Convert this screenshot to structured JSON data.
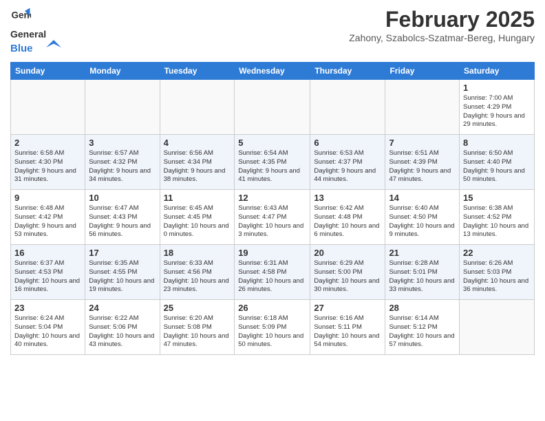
{
  "header": {
    "logo_general": "General",
    "logo_blue": "Blue",
    "month_title": "February 2025",
    "location": "Zahony, Szabolcs-Szatmar-Bereg, Hungary"
  },
  "weekdays": [
    "Sunday",
    "Monday",
    "Tuesday",
    "Wednesday",
    "Thursday",
    "Friday",
    "Saturday"
  ],
  "weeks": [
    [
      {
        "day": "",
        "info": ""
      },
      {
        "day": "",
        "info": ""
      },
      {
        "day": "",
        "info": ""
      },
      {
        "day": "",
        "info": ""
      },
      {
        "day": "",
        "info": ""
      },
      {
        "day": "",
        "info": ""
      },
      {
        "day": "1",
        "info": "Sunrise: 7:00 AM\nSunset: 4:29 PM\nDaylight: 9 hours and 29 minutes."
      }
    ],
    [
      {
        "day": "2",
        "info": "Sunrise: 6:58 AM\nSunset: 4:30 PM\nDaylight: 9 hours and 31 minutes."
      },
      {
        "day": "3",
        "info": "Sunrise: 6:57 AM\nSunset: 4:32 PM\nDaylight: 9 hours and 34 minutes."
      },
      {
        "day": "4",
        "info": "Sunrise: 6:56 AM\nSunset: 4:34 PM\nDaylight: 9 hours and 38 minutes."
      },
      {
        "day": "5",
        "info": "Sunrise: 6:54 AM\nSunset: 4:35 PM\nDaylight: 9 hours and 41 minutes."
      },
      {
        "day": "6",
        "info": "Sunrise: 6:53 AM\nSunset: 4:37 PM\nDaylight: 9 hours and 44 minutes."
      },
      {
        "day": "7",
        "info": "Sunrise: 6:51 AM\nSunset: 4:39 PM\nDaylight: 9 hours and 47 minutes."
      },
      {
        "day": "8",
        "info": "Sunrise: 6:50 AM\nSunset: 4:40 PM\nDaylight: 9 hours and 50 minutes."
      }
    ],
    [
      {
        "day": "9",
        "info": "Sunrise: 6:48 AM\nSunset: 4:42 PM\nDaylight: 9 hours and 53 minutes."
      },
      {
        "day": "10",
        "info": "Sunrise: 6:47 AM\nSunset: 4:43 PM\nDaylight: 9 hours and 56 minutes."
      },
      {
        "day": "11",
        "info": "Sunrise: 6:45 AM\nSunset: 4:45 PM\nDaylight: 10 hours and 0 minutes."
      },
      {
        "day": "12",
        "info": "Sunrise: 6:43 AM\nSunset: 4:47 PM\nDaylight: 10 hours and 3 minutes."
      },
      {
        "day": "13",
        "info": "Sunrise: 6:42 AM\nSunset: 4:48 PM\nDaylight: 10 hours and 6 minutes."
      },
      {
        "day": "14",
        "info": "Sunrise: 6:40 AM\nSunset: 4:50 PM\nDaylight: 10 hours and 9 minutes."
      },
      {
        "day": "15",
        "info": "Sunrise: 6:38 AM\nSunset: 4:52 PM\nDaylight: 10 hours and 13 minutes."
      }
    ],
    [
      {
        "day": "16",
        "info": "Sunrise: 6:37 AM\nSunset: 4:53 PM\nDaylight: 10 hours and 16 minutes."
      },
      {
        "day": "17",
        "info": "Sunrise: 6:35 AM\nSunset: 4:55 PM\nDaylight: 10 hours and 19 minutes."
      },
      {
        "day": "18",
        "info": "Sunrise: 6:33 AM\nSunset: 4:56 PM\nDaylight: 10 hours and 23 minutes."
      },
      {
        "day": "19",
        "info": "Sunrise: 6:31 AM\nSunset: 4:58 PM\nDaylight: 10 hours and 26 minutes."
      },
      {
        "day": "20",
        "info": "Sunrise: 6:29 AM\nSunset: 5:00 PM\nDaylight: 10 hours and 30 minutes."
      },
      {
        "day": "21",
        "info": "Sunrise: 6:28 AM\nSunset: 5:01 PM\nDaylight: 10 hours and 33 minutes."
      },
      {
        "day": "22",
        "info": "Sunrise: 6:26 AM\nSunset: 5:03 PM\nDaylight: 10 hours and 36 minutes."
      }
    ],
    [
      {
        "day": "23",
        "info": "Sunrise: 6:24 AM\nSunset: 5:04 PM\nDaylight: 10 hours and 40 minutes."
      },
      {
        "day": "24",
        "info": "Sunrise: 6:22 AM\nSunset: 5:06 PM\nDaylight: 10 hours and 43 minutes."
      },
      {
        "day": "25",
        "info": "Sunrise: 6:20 AM\nSunset: 5:08 PM\nDaylight: 10 hours and 47 minutes."
      },
      {
        "day": "26",
        "info": "Sunrise: 6:18 AM\nSunset: 5:09 PM\nDaylight: 10 hours and 50 minutes."
      },
      {
        "day": "27",
        "info": "Sunrise: 6:16 AM\nSunset: 5:11 PM\nDaylight: 10 hours and 54 minutes."
      },
      {
        "day": "28",
        "info": "Sunrise: 6:14 AM\nSunset: 5:12 PM\nDaylight: 10 hours and 57 minutes."
      },
      {
        "day": "",
        "info": ""
      }
    ]
  ]
}
